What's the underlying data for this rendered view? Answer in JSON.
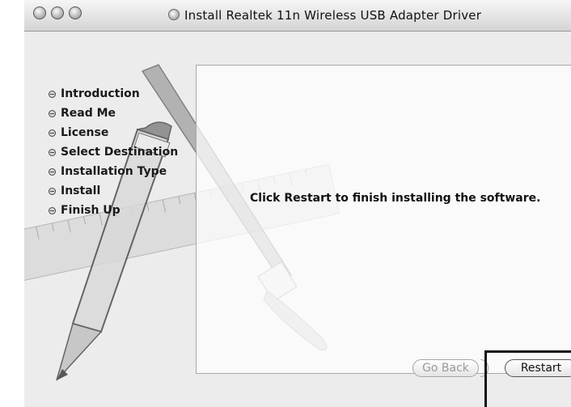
{
  "window": {
    "title": "Install Realtek 11n Wireless USB Adapter Driver"
  },
  "sidebar": {
    "steps": [
      {
        "label": "Introduction"
      },
      {
        "label": "Read Me"
      },
      {
        "label": "License"
      },
      {
        "label": "Select Destination"
      },
      {
        "label": "Installation Type"
      },
      {
        "label": "Install"
      },
      {
        "label": "Finish Up"
      }
    ]
  },
  "main": {
    "message": "Click Restart to finish installing the software."
  },
  "buttons": {
    "go_back": "Go Back",
    "restart": "Restart"
  },
  "colors": {
    "window_bg": "#ececec",
    "content_border": "#a9a9a9",
    "disabled_text": "#9a9a9a"
  }
}
